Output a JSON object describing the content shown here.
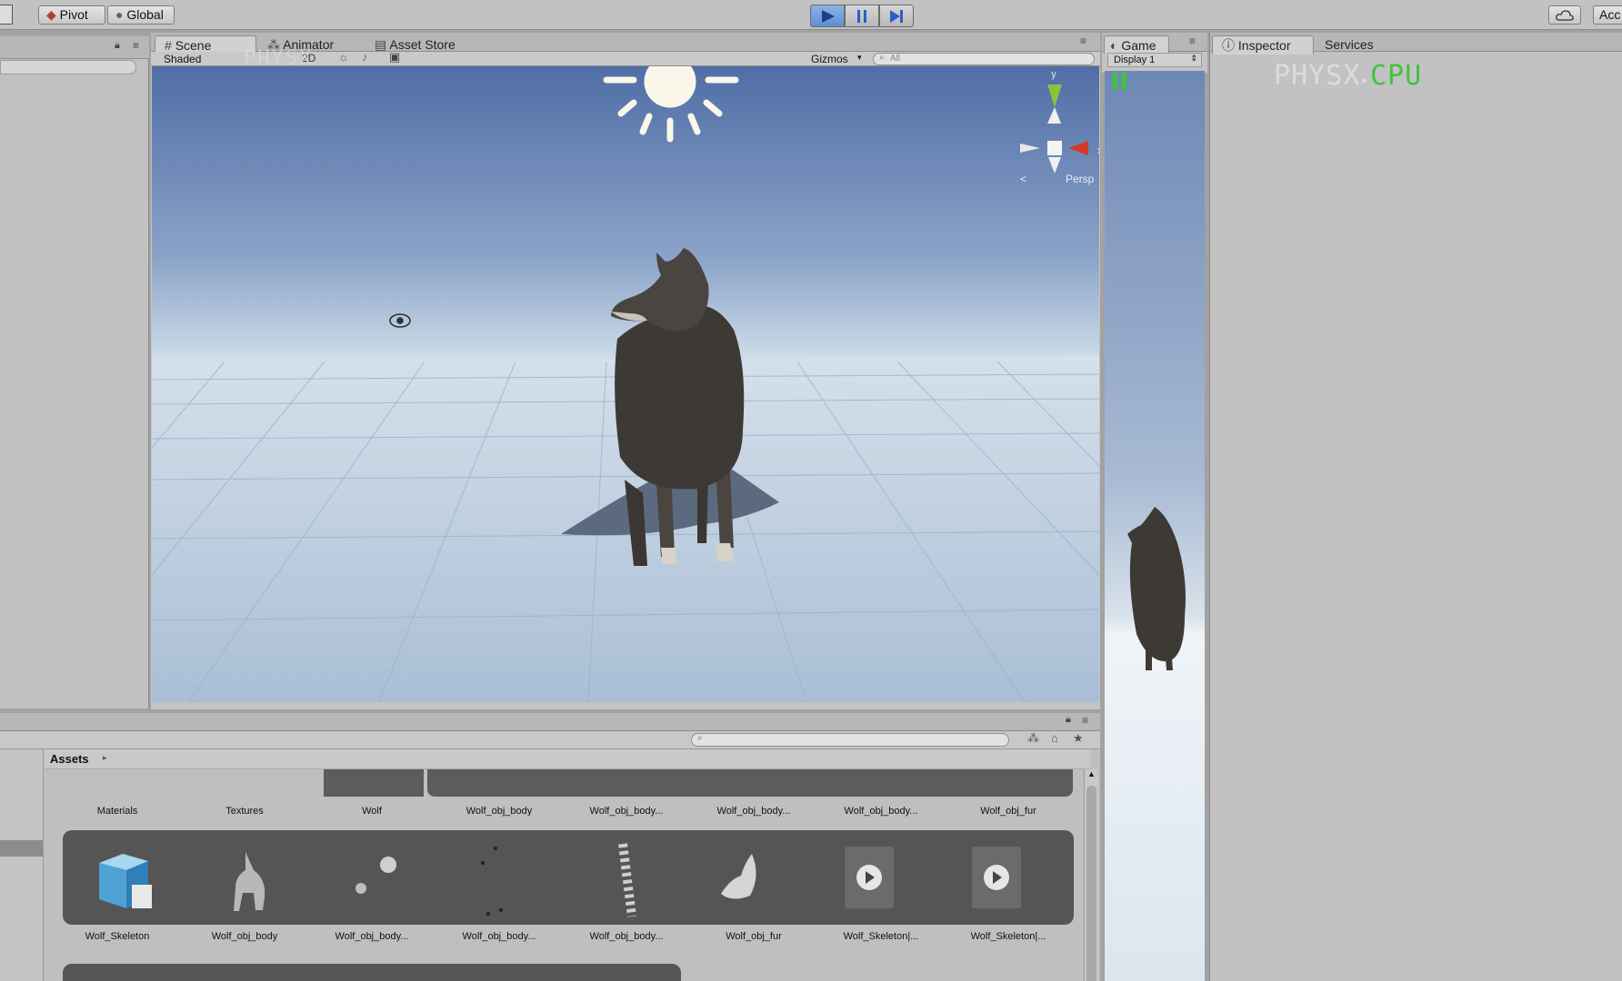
{
  "toolbar": {
    "pivot_label": "Pivot",
    "global_label": "Global",
    "account_label": "Acc"
  },
  "scene_panel": {
    "tabs": [
      {
        "label": "Scene",
        "selected": true
      },
      {
        "label": "Animator",
        "selected": false
      },
      {
        "label": "Asset Store",
        "selected": false
      }
    ],
    "shading_mode": "Shaded",
    "mode_2d": "2D",
    "gizmos_label": "Gizmos",
    "search_placeholder": "All",
    "persp_label": "Persp",
    "axis_y": "y",
    "axis_x": "x"
  },
  "game_panel": {
    "tab_label": "Game",
    "display_label": "Display 1"
  },
  "inspector_panel": {
    "tabs": [
      {
        "label": "Inspector",
        "selected": true
      },
      {
        "label": "Services",
        "selected": false
      }
    ]
  },
  "overlay": {
    "left": "PHYSX",
    "right": "CPU"
  },
  "project_panel": {
    "breadcrumb": "Assets",
    "row1": [
      "Materials",
      "Textures",
      "Wolf",
      "Wolf_obj_body",
      "Wolf_obj_body...",
      "Wolf_obj_body...",
      "Wolf_obj_body...",
      "Wolf_obj_fur"
    ],
    "row2": [
      "Wolf_Skeleton",
      "Wolf_obj_body",
      "Wolf_obj_body...",
      "Wolf_obj_body...",
      "Wolf_obj_body...",
      "Wolf_obj_fur",
      "Wolf_Skeleton|...",
      "Wolf_Skeleton|..."
    ]
  },
  "colors": {
    "accent_play": "#5f8fd1",
    "overlay_gray": "#cfcfcf",
    "overlay_green": "#3fc43f"
  }
}
